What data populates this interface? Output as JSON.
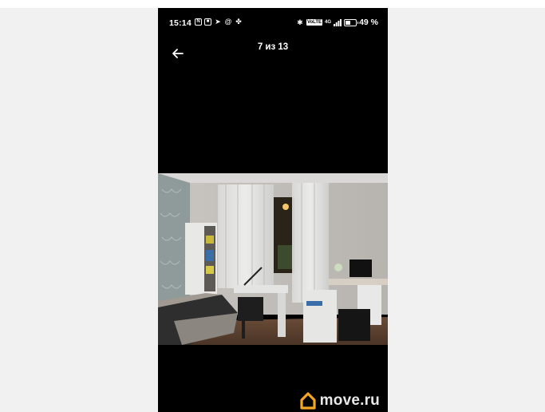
{
  "status_bar": {
    "time": "15:14",
    "left_icons": [
      "nfc-icon",
      "notification-icon",
      "telegram-icon",
      "at-icon",
      "clover-icon"
    ],
    "bluetooth_icon": "bluetooth-icon",
    "volte": "VoLTE",
    "network": "4G",
    "battery_percent_label": "49 %",
    "battery_level": 0.49
  },
  "header": {
    "back_icon": "arrow-left-icon",
    "counter": "7 из 13"
  },
  "watermark": {
    "logo_icon": "house-logo-icon",
    "text": "move.ru",
    "logo_color": "#f5a623"
  }
}
